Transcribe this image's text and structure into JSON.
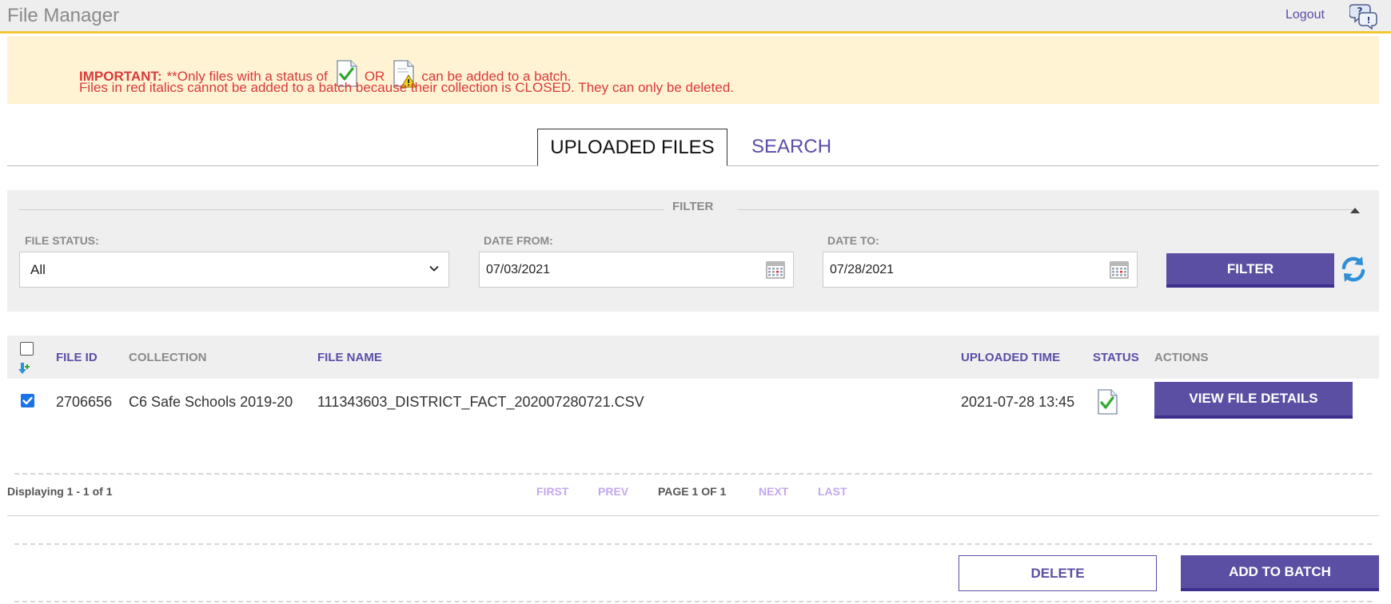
{
  "header": {
    "title": "File Manager",
    "logout_label": "Logout",
    "help_icon": "help-question-icon"
  },
  "notice": {
    "important_label": "IMPORTANT:",
    "line1_prefix": "**Only files with a status of",
    "line1_or": "OR",
    "line1_suffix": "can be added to a batch.",
    "line2": "Files in red italics cannot be added to a batch because their collection is CLOSED. They can only be deleted.",
    "icons": [
      "file-ok-icon",
      "file-warning-icon"
    ],
    "text_color": "#d93a3a",
    "background": "#fff3d4"
  },
  "tabs": [
    {
      "label": "UPLOADED FILES",
      "active": true
    },
    {
      "label": "SEARCH",
      "active": false
    }
  ],
  "filter": {
    "legend": "FILTER",
    "file_status_label": "FILE STATUS:",
    "file_status_value": "All",
    "date_from_label": "DATE FROM:",
    "date_from_value": "07/03/2021",
    "date_to_label": "DATE TO:",
    "date_to_value": "07/28/2021",
    "filter_button": "FILTER",
    "refresh_icon": "refresh-icon",
    "collapse_icon": "collapse-up-icon"
  },
  "table": {
    "columns": {
      "file_id": "FILE ID",
      "collection": "COLLECTION",
      "file_name": "FILE NAME",
      "uploaded_time": "UPLOADED TIME",
      "status": "STATUS",
      "actions": "ACTIONS"
    },
    "select_all_checked": false,
    "rows": [
      {
        "selected": true,
        "file_id": "2706656",
        "collection": "C6 Safe Schools 2019-20",
        "file_name": "111343603_DISTRICT_FACT_202007280721.CSV",
        "uploaded_time": "2021-07-28 13:45",
        "status_icon": "file-ok-icon",
        "action_label": "VIEW FILE DETAILS"
      }
    ]
  },
  "pagination": {
    "displaying": "Displaying 1 - 1 of 1",
    "first": "FIRST",
    "prev": "PREV",
    "page": "PAGE 1 OF 1",
    "next": "NEXT",
    "last": "LAST"
  },
  "footer": {
    "delete_label": "DELETE",
    "add_to_batch_label": "ADD TO BATCH"
  },
  "colors": {
    "primary": "#5b4fa3",
    "primary_dark": "#3c2f8e",
    "accent_bar": "#f2c832",
    "link_disabled": "#c3a8f0"
  }
}
